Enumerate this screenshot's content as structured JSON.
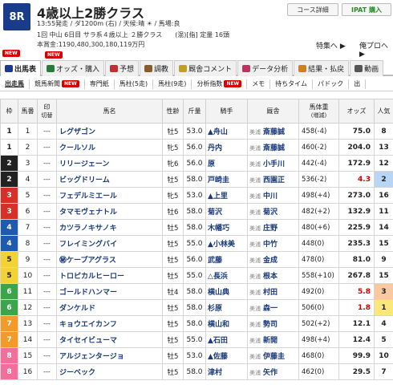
{
  "race": {
    "number": "8R",
    "title": "4歳以上2勝クラス",
    "info1": "13:55発走 / ダ1200m (右) / 天候:晴 ☀ / 馬場:良",
    "info2": "1回 中山 6日目 サラ系４歳以上 ２勝クラス　　(混)[指] 定量 16頭",
    "info3": "本賞金:1190,480,300,180,119万円"
  },
  "buttons": {
    "course": "コース詳細",
    "ipat": "IPAT 購入",
    "feature": "特集へ ▶",
    "favorite": "俺プロへ ▶"
  },
  "new_label": "NEW",
  "tabs": [
    {
      "label": "出馬表",
      "icon": "horse-icon"
    },
    {
      "label": "オッズ・購入",
      "icon": "chart-icon"
    },
    {
      "label": "予想",
      "icon": "target-icon"
    },
    {
      "label": "調教",
      "icon": "whistle-icon"
    },
    {
      "label": "厩舎コメント",
      "icon": "comment-icon"
    },
    {
      "label": "データ分析",
      "icon": "data-icon"
    },
    {
      "label": "結果・払戻",
      "icon": "trophy-icon"
    },
    {
      "label": "動画",
      "icon": "video-icon"
    }
  ],
  "subtabs": [
    "出走馬",
    "競馬新聞",
    "専門紙",
    "馬柱(5走)",
    "馬柱(9走)",
    "分析指数",
    "メモ",
    "持ちタイム",
    "パドック",
    "出"
  ],
  "columns": {
    "waku": "枠",
    "umaban": "馬番",
    "mark": "印",
    "kiri": "切替",
    "horse": "馬名",
    "sexage": "性齢",
    "kinryo": "斤量",
    "jockey": "騎手",
    "trainer": "厩舎",
    "weight": "馬体重",
    "weight_sub": "(増減)",
    "odds": "オッズ",
    "pop": "人気"
  },
  "entries": [
    {
      "waku": "1",
      "num": "1",
      "mark": "---",
      "horse": "レグザゴン",
      "sex": "牡5",
      "kinryo": "53.0",
      "jockey": "▲舟山",
      "area": "美浦",
      "trainer": "斎藤誠",
      "weight": "458(-4)",
      "odds": "75.0",
      "pop": "8"
    },
    {
      "waku": "1",
      "num": "2",
      "mark": "---",
      "horse": "クールソル",
      "sex": "牝5",
      "kinryo": "56.0",
      "jockey": "丹内",
      "area": "美浦",
      "trainer": "斎藤誠",
      "weight": "460(-2)",
      "odds": "204.0",
      "pop": "13"
    },
    {
      "waku": "2",
      "num": "3",
      "mark": "---",
      "horse": "リリージェーン",
      "sex": "牝6",
      "kinryo": "56.0",
      "jockey": "原",
      "area": "美浦",
      "trainer": "小手川",
      "weight": "442(-4)",
      "odds": "172.9",
      "pop": "12"
    },
    {
      "waku": "2",
      "num": "4",
      "mark": "---",
      "horse": "ビッグドリーム",
      "sex": "牡5",
      "kinryo": "58.0",
      "jockey": "戸崎圭",
      "area": "美浦",
      "trainer": "西園正",
      "weight": "536(-2)",
      "odds": "4.3",
      "pop": "2"
    },
    {
      "waku": "3",
      "num": "5",
      "mark": "---",
      "horse": "フェデルミエール",
      "sex": "牝5",
      "kinryo": "53.0",
      "jockey": "▲上里",
      "area": "美浦",
      "trainer": "中川",
      "weight": "498(+4)",
      "odds": "273.0",
      "pop": "16"
    },
    {
      "waku": "3",
      "num": "6",
      "mark": "---",
      "horse": "タマモヴェナトル",
      "sex": "牡6",
      "kinryo": "58.0",
      "jockey": "菊沢",
      "area": "美浦",
      "trainer": "菊沢",
      "weight": "482(+2)",
      "odds": "132.9",
      "pop": "11"
    },
    {
      "waku": "4",
      "num": "7",
      "mark": "---",
      "horse": "カツラノキサノキ",
      "sex": "牡5",
      "kinryo": "58.0",
      "jockey": "木幡巧",
      "area": "美浦",
      "trainer": "庄野",
      "weight": "480(+6)",
      "odds": "225.9",
      "pop": "14"
    },
    {
      "waku": "4",
      "num": "8",
      "mark": "---",
      "horse": "フレイミングバイ",
      "sex": "牡5",
      "kinryo": "55.0",
      "jockey": "▲小林美",
      "area": "美浦",
      "trainer": "中竹",
      "weight": "448(0)",
      "odds": "235.3",
      "pop": "15"
    },
    {
      "waku": "5",
      "num": "9",
      "mark": "---",
      "horse": "㊙ケープアグラス",
      "sex": "牡5",
      "kinryo": "56.0",
      "jockey": "武藤",
      "area": "美浦",
      "trainer": "金成",
      "weight": "478(0)",
      "odds": "81.0",
      "pop": "9"
    },
    {
      "waku": "5",
      "num": "10",
      "mark": "---",
      "horse": "トロピカルヒーロー",
      "sex": "牡5",
      "kinryo": "55.0",
      "jockey": "△長浜",
      "area": "美浦",
      "trainer": "根本",
      "weight": "558(+10)",
      "odds": "267.8",
      "pop": "15"
    },
    {
      "waku": "6",
      "num": "11",
      "mark": "---",
      "horse": "ゴールドハンマー",
      "sex": "牡4",
      "kinryo": "58.0",
      "jockey": "横山典",
      "area": "美浦",
      "trainer": "村田",
      "weight": "492(0)",
      "odds": "5.8",
      "pop": "3"
    },
    {
      "waku": "6",
      "num": "12",
      "mark": "---",
      "horse": "ダンケルド",
      "sex": "牡5",
      "kinryo": "58.0",
      "jockey": "杉原",
      "area": "美浦",
      "trainer": "森一",
      "weight": "506(0)",
      "odds": "1.8",
      "pop": "1"
    },
    {
      "waku": "7",
      "num": "13",
      "mark": "---",
      "horse": "キョウエイカンフ",
      "sex": "牡5",
      "kinryo": "58.0",
      "jockey": "横山和",
      "area": "美浦",
      "trainer": "勢司",
      "weight": "502(+2)",
      "odds": "12.1",
      "pop": "4"
    },
    {
      "waku": "7",
      "num": "14",
      "mark": "---",
      "horse": "タイセイビューマ",
      "sex": "牡5",
      "kinryo": "55.0",
      "jockey": "▲石田",
      "area": "美浦",
      "trainer": "新開",
      "weight": "498(+4)",
      "odds": "12.4",
      "pop": "5"
    },
    {
      "waku": "8",
      "num": "15",
      "mark": "---",
      "horse": "アルジェンタージョ",
      "sex": "牡5",
      "kinryo": "53.0",
      "jockey": "▲佐藤",
      "area": "美浦",
      "trainer": "伊藤圭",
      "weight": "468(0)",
      "odds": "99.9",
      "pop": "10"
    },
    {
      "waku": "8",
      "num": "16",
      "mark": "---",
      "horse": "ジーベック",
      "sex": "牡5",
      "kinryo": "58.0",
      "jockey": "津村",
      "area": "美浦",
      "trainer": "矢作",
      "weight": "462(0)",
      "odds": "29.5",
      "pop": "7"
    }
  ]
}
